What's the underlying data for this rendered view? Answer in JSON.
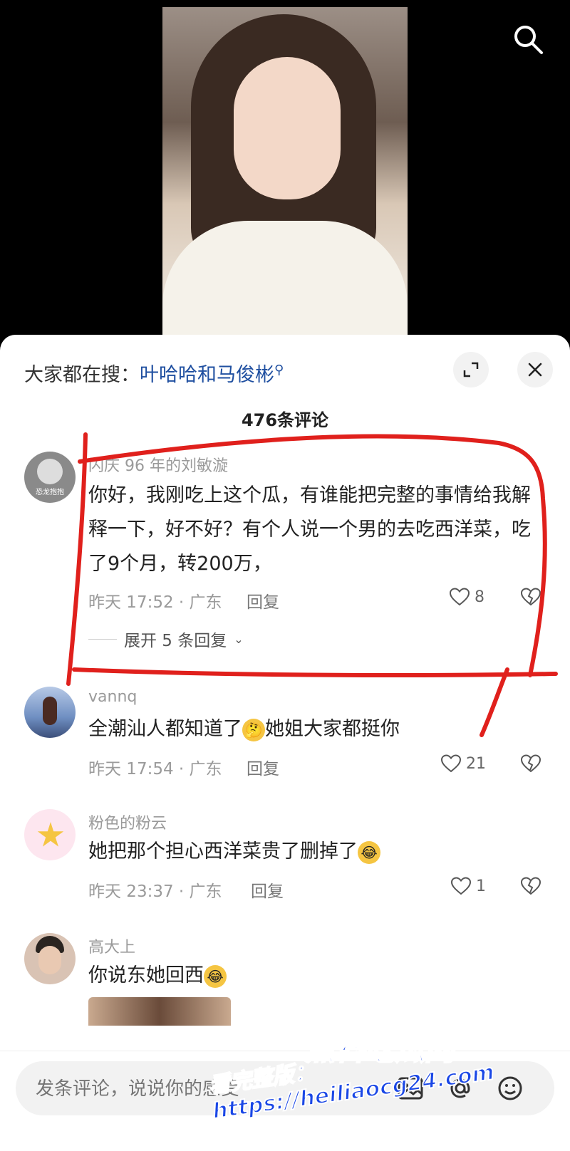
{
  "trending": {
    "prefix": "大家都在搜：",
    "keyword": "叶哈哈和马俊彬"
  },
  "comment_count": "476条评论",
  "comments": [
    {
      "username": "闪庆 96 年的刘敏漩",
      "avatar_text": "恐龙抱抱",
      "text": "你好，我刚吃上这个瓜，有谁能把完整的事情给我解释一下，好不好？有个人说一个男的去吃西洋菜，吃了9个月，转200万，",
      "time": "昨天 17:52 · 广东",
      "reply_label": "回复",
      "likes": "8",
      "expand_label": "展开 5 条回复"
    },
    {
      "username": "vannq",
      "text_before": "全潮汕人都知道了",
      "text_after": "她姐大家都挺你",
      "emoji": "🤔",
      "time": "昨天 17:54 · 广东",
      "reply_label": "回复",
      "likes": "21"
    },
    {
      "username": "粉色的粉云",
      "text_before": "她把那个担心西洋菜贵了删掉了",
      "emoji": "😂",
      "time": "昨天 23:37 · 广东",
      "reply_label": "回复",
      "likes": "1"
    },
    {
      "username": "高大上",
      "text_before": "你说东她回西",
      "emoji": "😂"
    }
  ],
  "input": {
    "placeholder": "发条评论，说说你的感受"
  },
  "watermark": {
    "line1": "黑料吃瓜网",
    "line2": "看完整版：https://heiliaocg24.com"
  },
  "colors": {
    "accent_link": "#1f4fa0",
    "annotation": "#e0201c",
    "watermark": "#1a47e6"
  }
}
